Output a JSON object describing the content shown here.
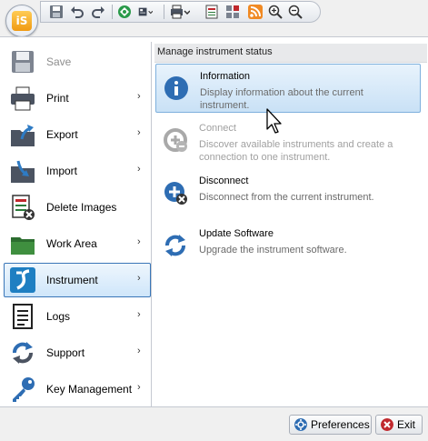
{
  "app": {
    "logo_text": "iS"
  },
  "qat": {
    "icons": [
      "save-icon",
      "undo-icon",
      "redo-icon",
      "instrument-status-icon",
      "view-dropdown-icon",
      "print-dropdown-icon",
      "report-icon",
      "grid-icon",
      "rss-icon",
      "zoom-in-icon",
      "zoom-out-icon"
    ]
  },
  "menu": {
    "items": [
      {
        "label": "Save",
        "icon": "save-icon",
        "arrow": "",
        "disabled": true
      },
      {
        "label": "Print",
        "icon": "printer-icon",
        "arrow": "›"
      },
      {
        "label": "Export",
        "icon": "export-icon",
        "arrow": "›"
      },
      {
        "label": "Import",
        "icon": "import-icon",
        "arrow": "›"
      },
      {
        "label": "Delete Images",
        "icon": "delete-images-icon",
        "arrow": ""
      },
      {
        "label": "Work Area",
        "icon": "folder-icon",
        "arrow": "›"
      },
      {
        "label": "Instrument",
        "icon": "instrument-icon",
        "arrow": "›",
        "selected": true
      },
      {
        "label": "Logs",
        "icon": "logs-icon",
        "arrow": "›"
      },
      {
        "label": "Support",
        "icon": "support-icon",
        "arrow": "›"
      },
      {
        "label": "Key Management",
        "icon": "key-icon",
        "arrow": "›"
      }
    ]
  },
  "submenu": {
    "header": "Manage instrument status",
    "items": [
      {
        "title": "Information",
        "desc": "Display information about the current instrument.",
        "icon": "info-icon",
        "selected": true
      },
      {
        "title": "Connect",
        "desc": "Discover available instruments and create a connection to one instrument.",
        "icon": "connect-icon",
        "disabled": true
      },
      {
        "title": "Disconnect",
        "desc": "Disconnect from the current instrument.",
        "icon": "disconnect-icon"
      },
      {
        "title": "Update Software",
        "desc": "Upgrade the instrument software.",
        "icon": "update-icon"
      }
    ]
  },
  "footer": {
    "preferences_label": "Preferences",
    "exit_label": "Exit"
  },
  "colors": {
    "accent": "#3a76b8",
    "selection": "#cfe6fa",
    "info_blue": "#2e6db3",
    "exit_red": "#c0282d"
  }
}
